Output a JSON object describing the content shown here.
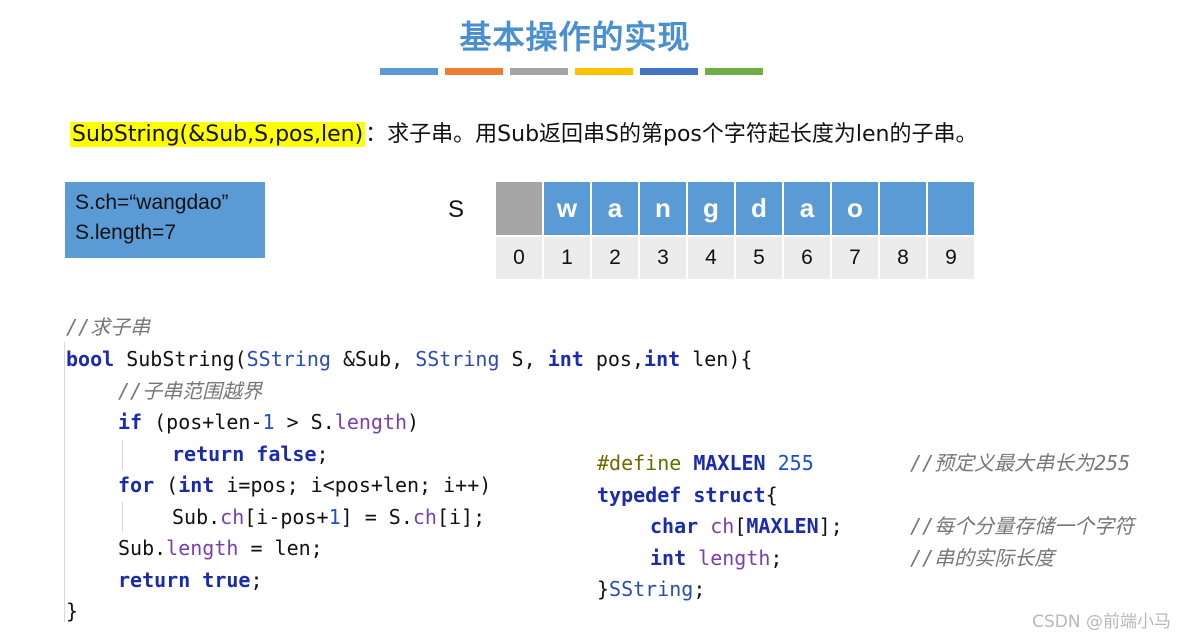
{
  "slide": {
    "title": "基本操作的实现",
    "title_bar_colors": [
      "#5b9bd5",
      "#ed7d31",
      "#a5a5a5",
      "#ffc000",
      "#4472c4",
      "#70ad47"
    ]
  },
  "description": {
    "signature": "SubString(&Sub,S,pos,len)",
    "text": "：求子串。用Sub返回串S的第pos个字符起长度为len的子串。"
  },
  "info_box": {
    "line1": "S.ch=“wangdao”",
    "line2": "S.length=7"
  },
  "array": {
    "label": "S",
    "cells": [
      "",
      "w",
      "a",
      "n",
      "g",
      "d",
      "a",
      "o",
      "",
      ""
    ],
    "indices": [
      "0",
      "1",
      "2",
      "3",
      "4",
      "5",
      "6",
      "7",
      "8",
      "9"
    ]
  },
  "code": {
    "l1": "//求子串",
    "l2_kw": "bool",
    "l2_a": " SubString(",
    "l2_t1": "SString",
    "l2_b": " &Sub, ",
    "l2_t2": "SString",
    "l2_c": " S, ",
    "l2_kw2": "int",
    "l2_d": " pos,",
    "l2_kw3": "int",
    "l2_e": " len){",
    "l3": "//子串范围越界",
    "l4_kw": "if",
    "l4_a": " (pos+len-",
    "l4_n": "1",
    "l4_b": " > S.",
    "l4_f": "length",
    "l4_c": ")",
    "l5_kw": "return",
    "l5_a": " ",
    "l5_kw2": "false",
    "l5_b": ";",
    "l6_kw": "for",
    "l6_a": " (",
    "l6_kw2": "int",
    "l6_b": " i=pos; i<pos+len; i++)",
    "l7_a": "Sub.",
    "l7_f": "ch",
    "l7_b": "[i-pos+",
    "l7_n": "1",
    "l7_c": "] = S.",
    "l7_f2": "ch",
    "l7_d": "[i];",
    "l8_a": "Sub.",
    "l8_f": "length",
    "l8_b": " = len;",
    "l9_kw": "return",
    "l9_a": " ",
    "l9_kw2": "true",
    "l9_b": ";",
    "l10": "}"
  },
  "code2": {
    "d1_pp": "#define",
    "d1_a": " ",
    "d1_m": "MAXLEN",
    "d1_b": " ",
    "d1_n": "255",
    "d1_cm": "//预定义最大串长为255",
    "d2_kw": "typedef",
    "d2_a": " ",
    "d2_kw2": "struct",
    "d2_b": "{",
    "d3_kw": "char",
    "d3_a": " ",
    "d3_f": "ch",
    "d3_b": "[",
    "d3_m": "MAXLEN",
    "d3_c": "];",
    "d3_cm": "//每个分量存储一个字符",
    "d4_kw": "int",
    "d4_a": " ",
    "d4_f": "length",
    "d4_b": ";",
    "d4_cm": "//串的实际长度",
    "d5_a": "}",
    "d5_t": "SString",
    "d5_b": ";"
  },
  "watermark": "CSDN @前端小马"
}
